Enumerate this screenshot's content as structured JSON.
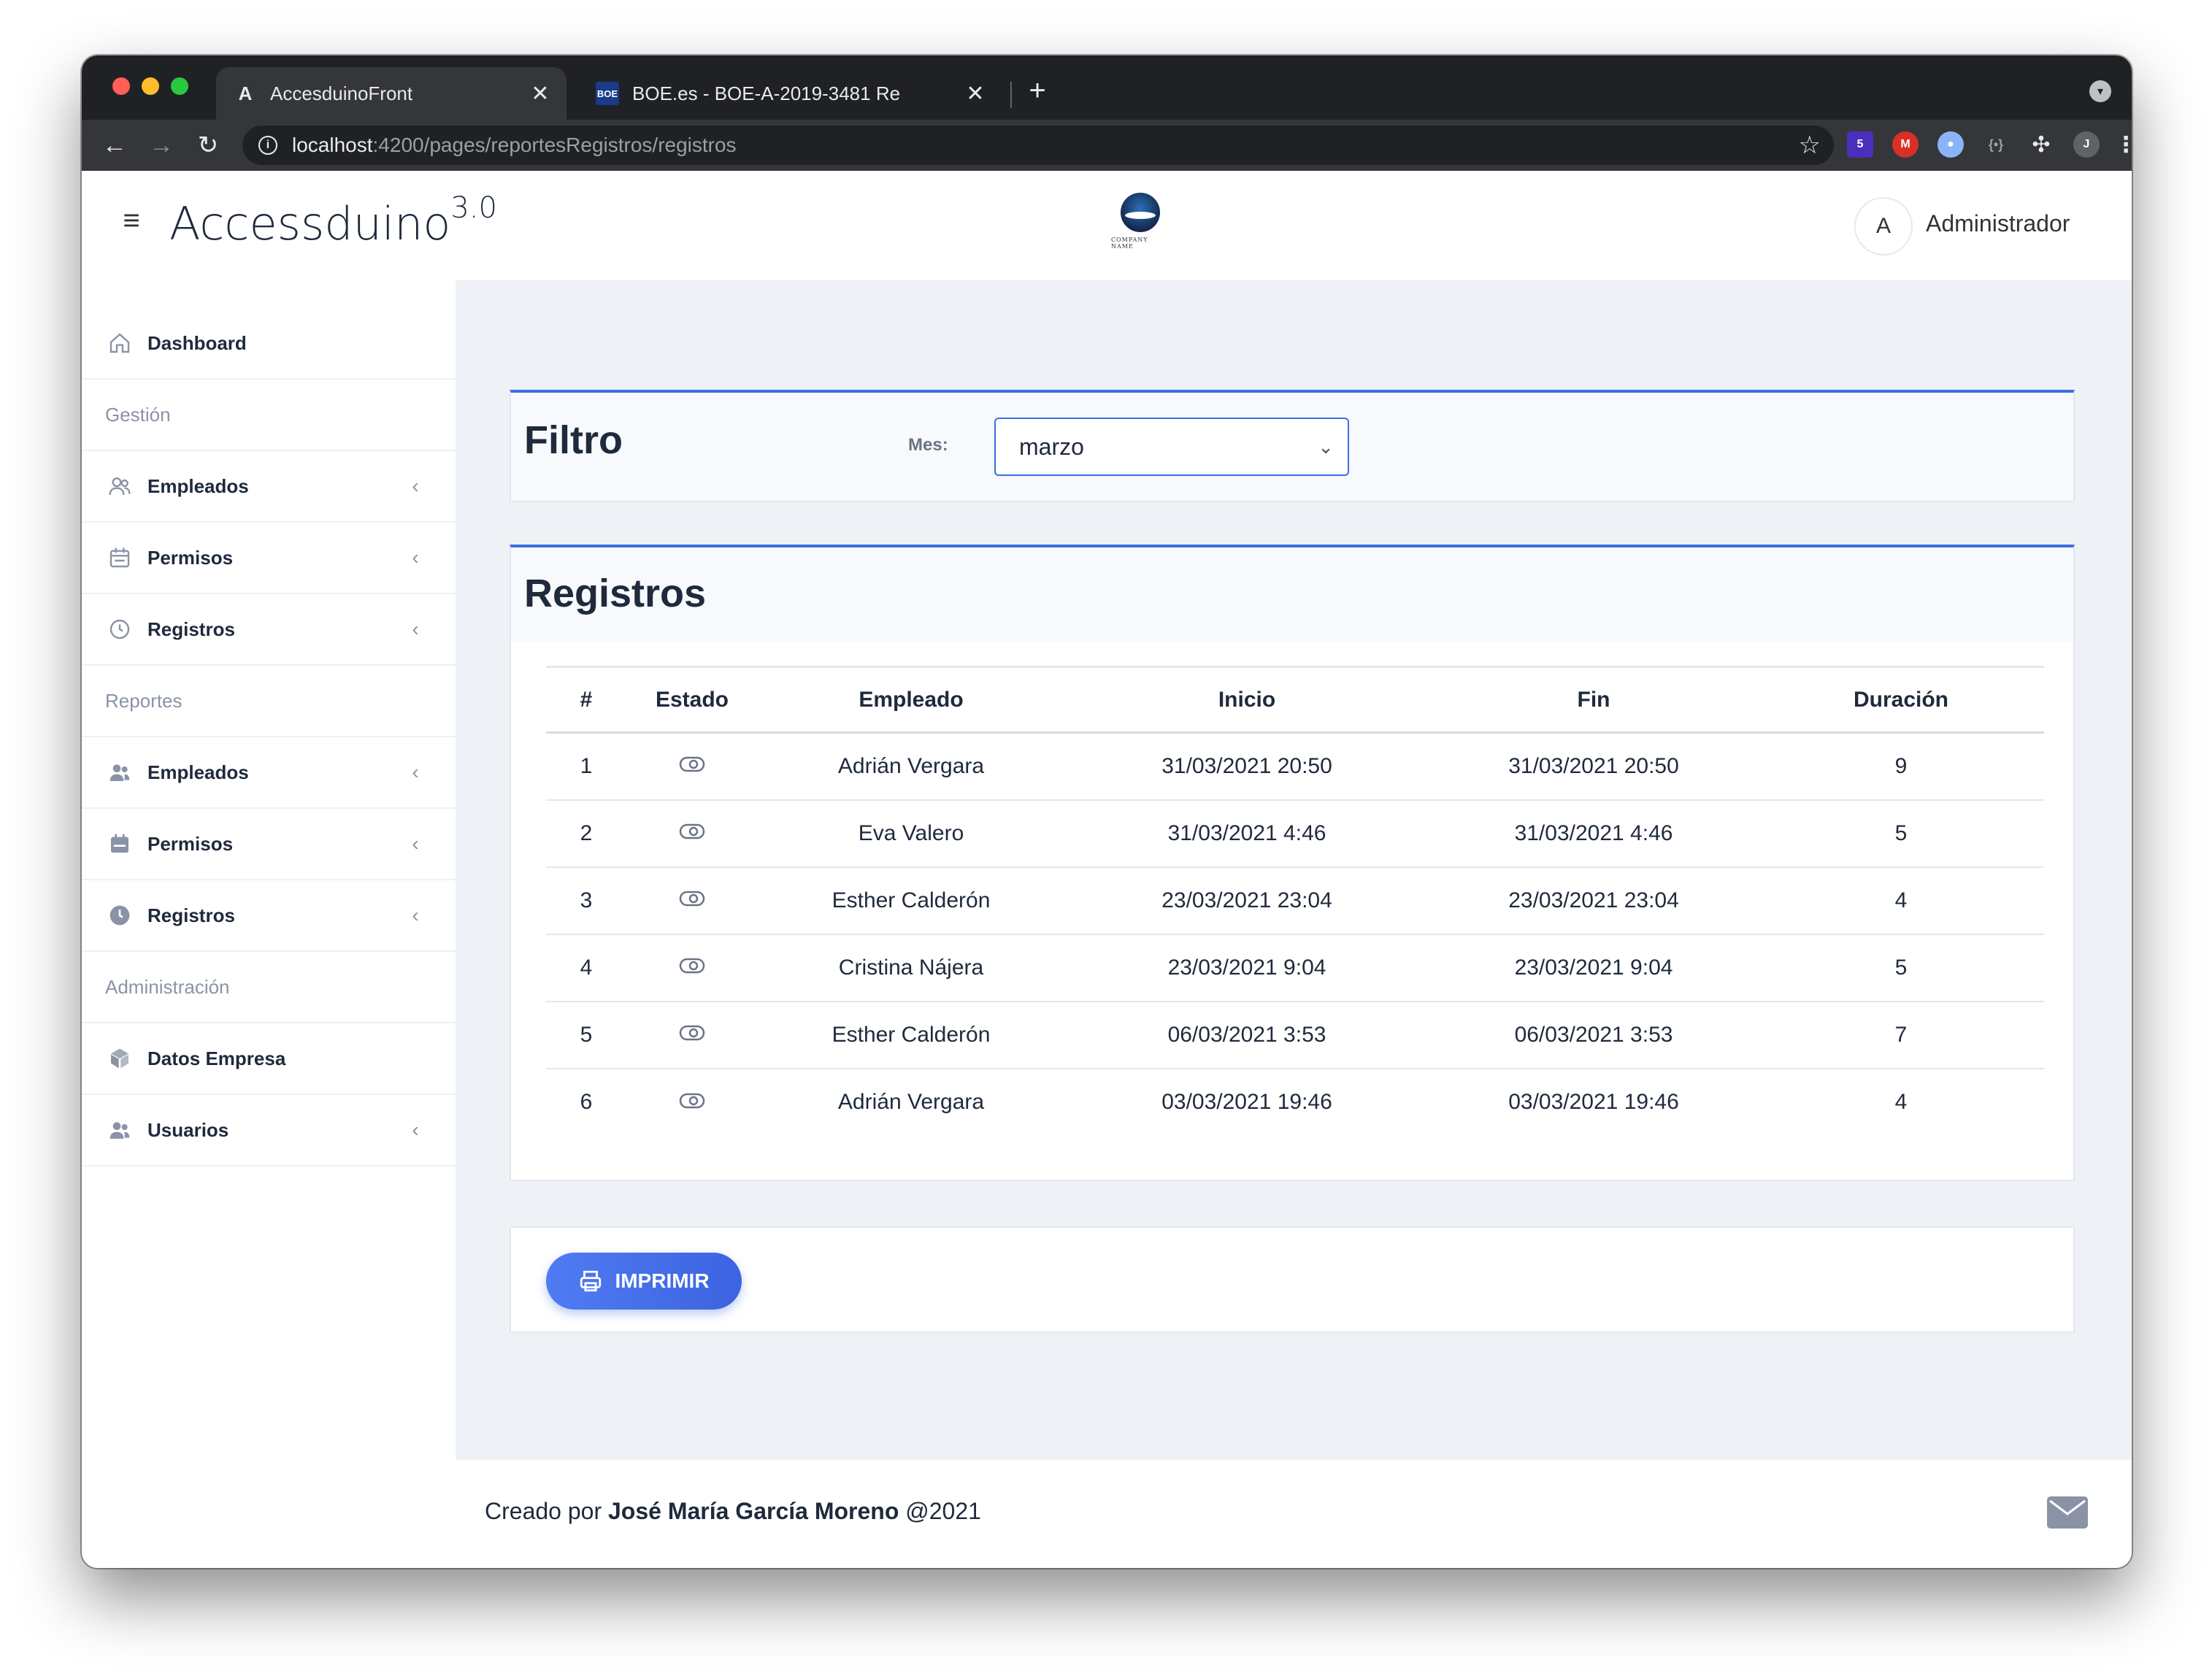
{
  "browser": {
    "tabs": [
      {
        "favicon": "A",
        "title": "AccesduinoFront",
        "close": "✕"
      },
      {
        "favicon": "BOE",
        "title": "BOE.es - BOE-A-2019-3481 Re",
        "close": "✕"
      }
    ],
    "new_tab": "+",
    "url_host": "localhost",
    "url_path": ":4200/pages/reportesRegistros/registros",
    "extensions": {
      "badge_count": "5",
      "profile_initial": "J"
    }
  },
  "header": {
    "menu_icon": "≡",
    "brand": "Accessduino",
    "brand_version": "3.0",
    "logo_text": "COMPANY NAME",
    "user_initial": "A",
    "user_name": "Administrador"
  },
  "sidebar": {
    "dashboard": "Dashboard",
    "sections": {
      "gestion": "Gestión",
      "reportes": "Reportes",
      "administracion": "Administración"
    },
    "gestion_items": [
      "Empleados",
      "Permisos",
      "Registros"
    ],
    "reportes_items": [
      "Empleados",
      "Permisos",
      "Registros"
    ],
    "admin_items": [
      "Datos Empresa",
      "Usuarios"
    ]
  },
  "filter": {
    "title": "Filtro",
    "label": "Mes:",
    "selected": "marzo"
  },
  "registros": {
    "title": "Registros",
    "columns": [
      "#",
      "Estado",
      "Empleado",
      "Inicio",
      "Fin",
      "Duración"
    ],
    "rows": [
      {
        "n": "1",
        "empleado": "Adrián Vergara",
        "inicio": "31/03/2021 20:50",
        "fin": "31/03/2021 20:50",
        "duracion": "9"
      },
      {
        "n": "2",
        "empleado": "Eva Valero",
        "inicio": "31/03/2021 4:46",
        "fin": "31/03/2021 4:46",
        "duracion": "5"
      },
      {
        "n": "3",
        "empleado": "Esther Calderón",
        "inicio": "23/03/2021 23:04",
        "fin": "23/03/2021 23:04",
        "duracion": "4"
      },
      {
        "n": "4",
        "empleado": "Cristina Nájera",
        "inicio": "23/03/2021 9:04",
        "fin": "23/03/2021 9:04",
        "duracion": "5"
      },
      {
        "n": "5",
        "empleado": "Esther Calderón",
        "inicio": "06/03/2021 3:53",
        "fin": "06/03/2021 3:53",
        "duracion": "7"
      },
      {
        "n": "6",
        "empleado": "Adrián Vergara",
        "inicio": "03/03/2021 19:46",
        "fin": "03/03/2021 19:46",
        "duracion": "4"
      }
    ]
  },
  "print_button": "IMPRIMIR",
  "footer": {
    "prefix": "Creado por",
    "author": "José María García Moreno",
    "suffix": "@2021"
  },
  "colors": {
    "accent": "#3b6fe0",
    "text": "#1f2a3c",
    "background": "#eef1f6"
  }
}
